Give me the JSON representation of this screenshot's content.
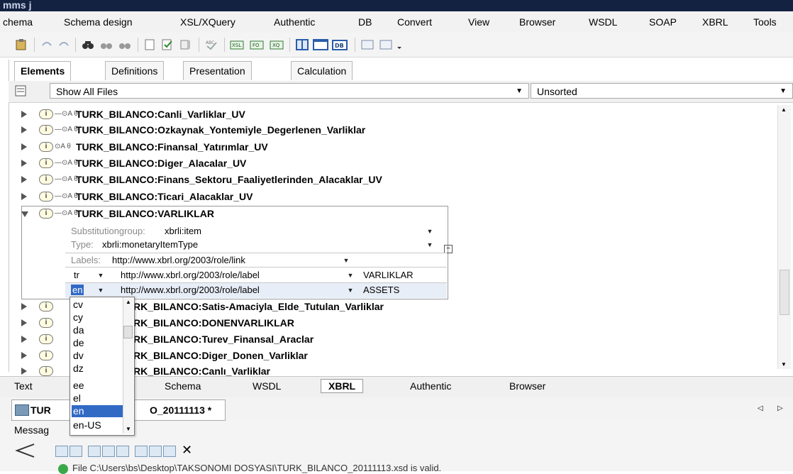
{
  "window": {
    "title_fragment": "mms j"
  },
  "menu": [
    "chema",
    "Schema design",
    "XSL/XQuery",
    "Authentic",
    "DB",
    "Convert",
    "View",
    "Browser",
    "WSDL",
    "SOAP",
    "XBRL",
    "Tools"
  ],
  "tabs": [
    "Elements",
    "Definitions",
    "Presentation",
    "Calculation"
  ],
  "filter": {
    "files": "Show All Files",
    "sort": "Unsorted"
  },
  "tree": [
    {
      "name": "TURK_BILANCO:Canli_Varliklar_UV",
      "marks": "—⊙A θ"
    },
    {
      "name": "TURK_BILANCO:Ozkaynak_Yontemiyle_Degerlenen_Varliklar",
      "marks": "—⊙A θ"
    },
    {
      "name": "TURK_BILANCO:Finansal_Yatırımlar_UV",
      "marks": "⊙A θ"
    },
    {
      "name": "TURK_BILANCO:Diger_Alacalar_UV",
      "marks": "—⊙A θ"
    },
    {
      "name": "TURK_BILANCO:Finans_Sektoru_Faaliyetlerinden_Alacaklar_UV",
      "marks": "—⊙A θ"
    },
    {
      "name": "TURK_BILANCO:Ticari_Alacaklar_UV",
      "marks": "—⊙A θ"
    },
    {
      "name": "TURK_BILANCO:VARLIKLAR",
      "marks": "—⊙A θ"
    }
  ],
  "tree_after": [
    "RK_BILANCO:Satis-Amaciyla_Elde_Tutulan_Varliklar",
    "RK_BILANCO:DONENVARLIKLAR",
    "RK_BILANCO:Turev_Finansal_Araclar",
    "RK_BILANCO:Diger_Donen_Varliklar",
    "RK_BILANCO:Canlı_Varliklar"
  ],
  "detail": {
    "substitution_label": "Substitutiongroup:",
    "substitution_value": "xbrli:item",
    "type_label": "Type:",
    "type_value": "xbrli:monetaryItemType",
    "labels_label": "Labels:",
    "labels_value": "http://www.xbrl.org/2003/role/link",
    "rows": [
      {
        "lang": "tr",
        "role": "http://www.xbrl.org/2003/role/label",
        "text": "VARLIKLAR"
      },
      {
        "lang": "en",
        "role": "http://www.xbrl.org/2003/role/label",
        "text": "ASSETS"
      }
    ]
  },
  "lang_options": [
    "cv",
    "cy",
    "da",
    "de",
    "dv",
    "dz",
    "ee",
    "el",
    "en",
    "en-US"
  ],
  "lang_selected": "en",
  "view_tabs": [
    "Text",
    "Schema",
    "WSDL",
    "XBRL",
    "Authentic",
    "Browser"
  ],
  "view_tab_active": "XBRL",
  "doc_tab": {
    "prefix": "TUR",
    "suffix": "O_20111113 *"
  },
  "messages": {
    "label": "Messag",
    "status": "File C:\\Users\\bs\\Desktop\\TAKSONOMI DOSYASI\\TURK_BILANCO_20111113.xsd is valid."
  }
}
